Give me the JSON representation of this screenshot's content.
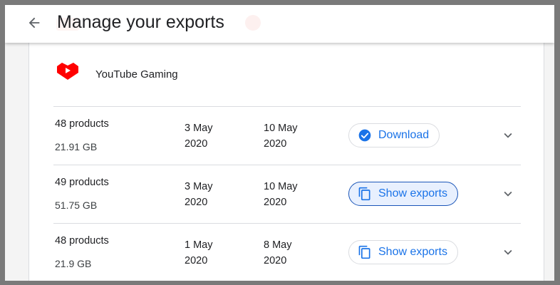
{
  "header": {
    "title": "Manage your exports",
    "back_icon": "arrow-back-icon"
  },
  "product": {
    "name": "YouTube Gaming",
    "icon": "youtube-gaming-logo",
    "brand_color": "#ff0000"
  },
  "accent_color": "#1a73e8",
  "exports": [
    {
      "count": "48 products",
      "size": "21.91 GB",
      "created_line1": "3 May",
      "created_line2": "2020",
      "expires_line1": "10 May",
      "expires_line2": "2020",
      "action_label": "Download",
      "action_icon": "check-circle-icon",
      "expand_icon": "chevron-down-icon"
    },
    {
      "count": "49 products",
      "size": "51.75 GB",
      "created_line1": "3 May",
      "created_line2": "2020",
      "expires_line1": "10 May",
      "expires_line2": "2020",
      "action_label": "Show exports",
      "action_icon": "copy-icon",
      "expand_icon": "chevron-down-icon"
    },
    {
      "count": "48 products",
      "size": "21.9 GB",
      "created_line1": "1 May",
      "created_line2": "2020",
      "expires_line1": "8 May",
      "expires_line2": "2020",
      "action_label": "Show exports",
      "action_icon": "copy-icon",
      "expand_icon": "chevron-down-icon"
    }
  ]
}
